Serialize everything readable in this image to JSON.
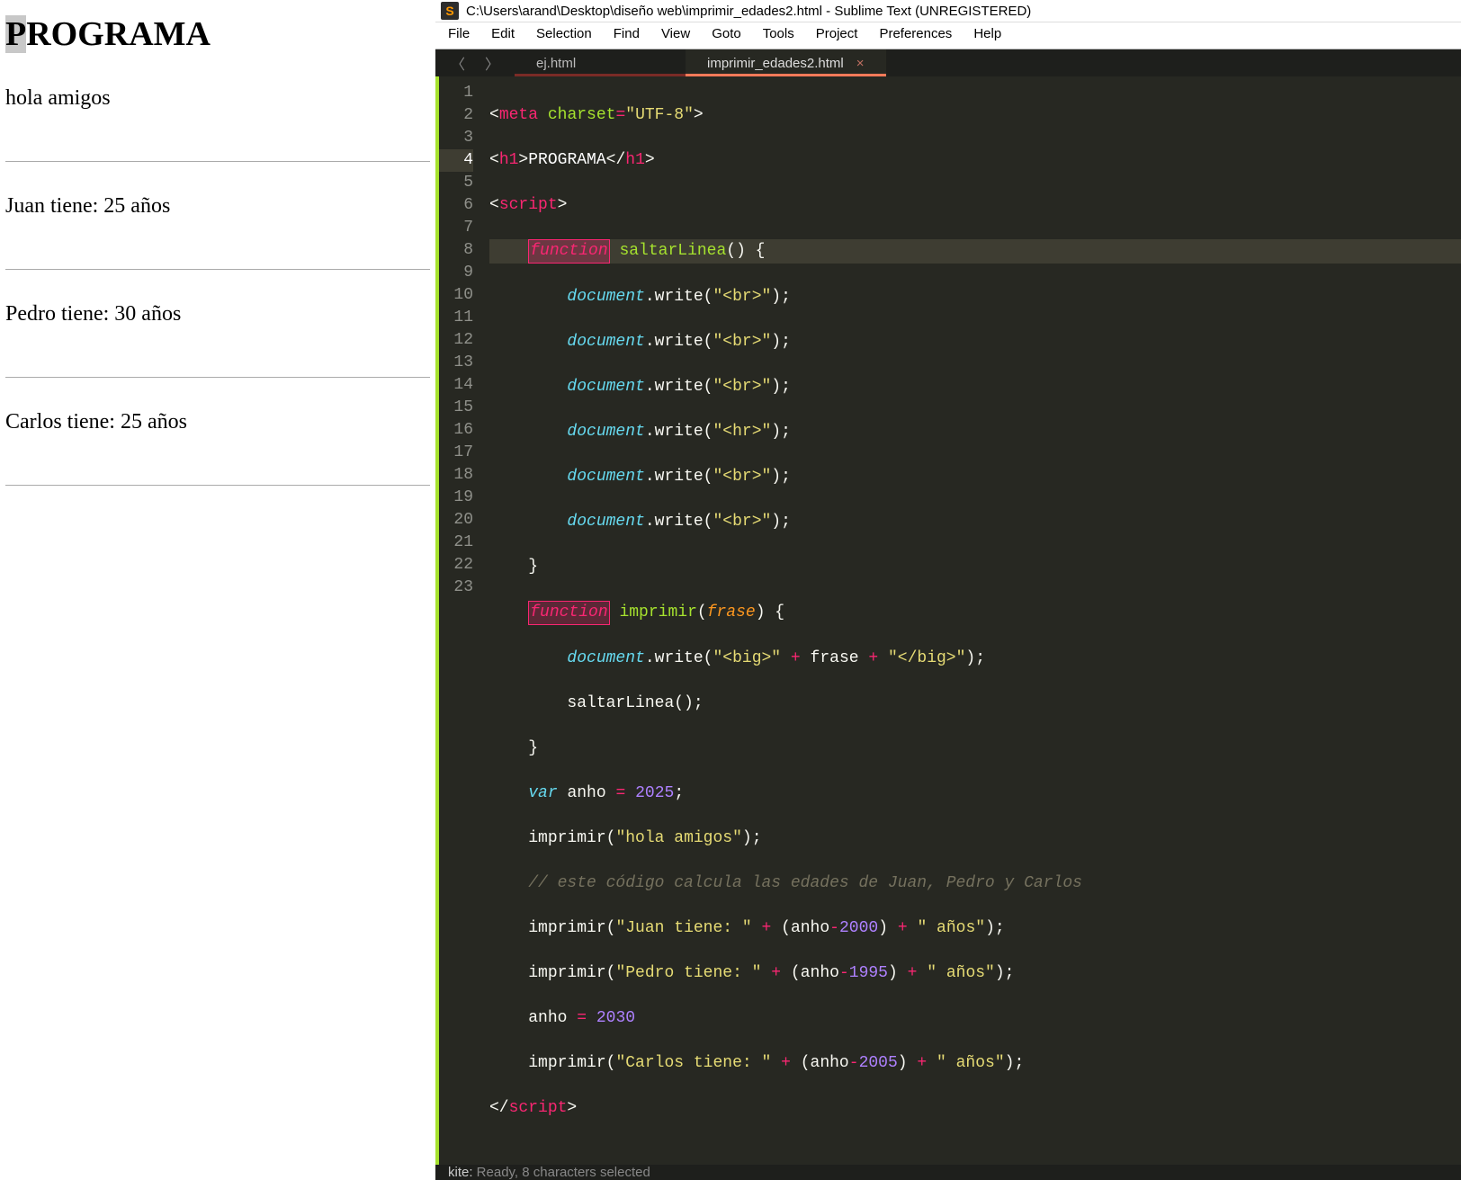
{
  "browser": {
    "heading_first": "P",
    "heading_rest": "ROGRAMA",
    "lines": [
      "hola amigos",
      "Juan tiene: 25 años",
      "Pedro tiene: 30 años",
      "Carlos tiene: 25 años"
    ]
  },
  "sublime": {
    "title": "C:\\Users\\arand\\Desktop\\diseño web\\imprimir_edades2.html - Sublime Text (UNREGISTERED)",
    "menu": [
      "File",
      "Edit",
      "Selection",
      "Find",
      "View",
      "Goto",
      "Tools",
      "Project",
      "Preferences",
      "Help"
    ],
    "tabs": [
      {
        "label": "ej.html",
        "active": false,
        "dirty": true
      },
      {
        "label": "imprimir_edades2.html",
        "active": true,
        "dirty": false
      }
    ],
    "status": {
      "kite_label": "kite:",
      "kite_text": " Ready, 8 characters selected"
    },
    "active_line": 4,
    "code": {
      "l1": {
        "tag": "meta",
        "attr": "charset",
        "val": "\"UTF-8\""
      },
      "l2": {
        "open": "h1",
        "text": "PROGRAMA",
        "close": "h1"
      },
      "l3": {
        "tag": "script"
      },
      "l4": {
        "kw": "function",
        "fn": "saltarLinea"
      },
      "l5": {
        "obj": "document",
        "m": "write",
        "arg": "\"<br>\""
      },
      "l6": {
        "obj": "document",
        "m": "write",
        "arg": "\"<br>\""
      },
      "l7": {
        "obj": "document",
        "m": "write",
        "arg": "\"<br>\""
      },
      "l8": {
        "obj": "document",
        "m": "write",
        "arg": "\"<hr>\""
      },
      "l9": {
        "obj": "document",
        "m": "write",
        "arg": "\"<br>\""
      },
      "l10": {
        "obj": "document",
        "m": "write",
        "arg": "\"<br>\""
      },
      "l11": {
        "brace": "}"
      },
      "l12": {
        "kw": "function",
        "fn": "imprimir",
        "param": "frase"
      },
      "l13": {
        "obj": "document",
        "m": "write",
        "s1": "\"<big>\"",
        "plus": "+",
        "var": "frase",
        "s2": "\"</big>\""
      },
      "l14": {
        "call": "saltarLinea"
      },
      "l15": {
        "brace": "}"
      },
      "l16": {
        "kw": "var",
        "name": "anho",
        "eq": "=",
        "val": "2025"
      },
      "l17": {
        "call": "imprimir",
        "arg": "\"hola amigos\""
      },
      "l18": {
        "comment": "// este código calcula las edades de Juan, Pedro y Carlos"
      },
      "l19": {
        "call": "imprimir",
        "s1": "\"Juan tiene: \"",
        "v": "anho",
        "n": "2000",
        "s2": "\" años\""
      },
      "l20": {
        "call": "imprimir",
        "s1": "\"Pedro tiene: \"",
        "v": "anho",
        "n": "1995",
        "s2": "\" años\""
      },
      "l21": {
        "name": "anho",
        "eq": "=",
        "val": "2030"
      },
      "l22": {
        "call": "imprimir",
        "s1": "\"Carlos tiene: \"",
        "v": "anho",
        "n": "2005",
        "s2": "\" años\""
      },
      "l23": {
        "close": "script"
      }
    },
    "line_count": 23
  }
}
